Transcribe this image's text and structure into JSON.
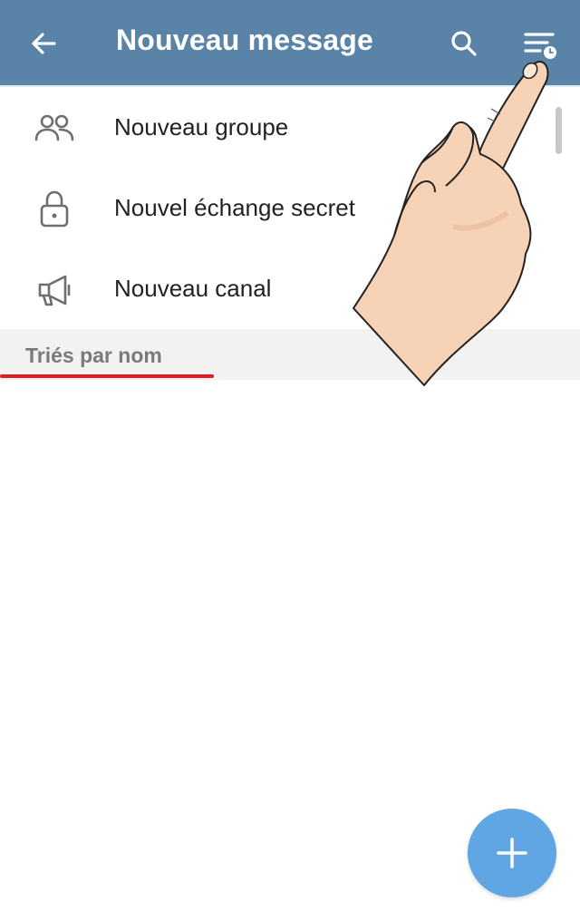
{
  "header": {
    "title": "Nouveau message",
    "back_icon": "arrow-left-icon",
    "search_icon": "search-icon",
    "sort_icon": "sort-clock-icon",
    "background_color": "#5a83a8"
  },
  "menu": {
    "items": [
      {
        "label": "Nouveau groupe",
        "icon": "group-icon"
      },
      {
        "label": "Nouvel échange secret",
        "icon": "lock-icon"
      },
      {
        "label": "Nouveau canal",
        "icon": "megaphone-icon"
      }
    ]
  },
  "section": {
    "label": "Triés par nom",
    "underline_color": "#e31b23"
  },
  "fab": {
    "icon": "plus-icon",
    "color": "#5fa6e2"
  },
  "overlay": {
    "icon": "pointing-hand-icon"
  }
}
